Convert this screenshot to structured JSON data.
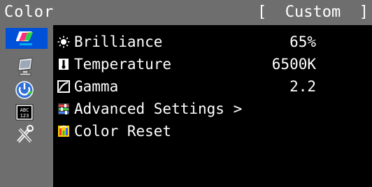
{
  "header": {
    "title": "Color",
    "mode_open": "[",
    "mode_value": "Custom",
    "mode_close": "]"
  },
  "sidebar": {
    "items": [
      {
        "icon": "color-icon",
        "selected": true
      },
      {
        "icon": "screen-icon",
        "selected": false
      },
      {
        "icon": "power-icon",
        "selected": false
      },
      {
        "icon": "language-icon",
        "selected": false
      },
      {
        "icon": "tools-icon",
        "selected": false
      }
    ]
  },
  "menu": {
    "items": [
      {
        "icon": "brilliance-icon",
        "label": "Brilliance",
        "value": "65%"
      },
      {
        "icon": "temperature-icon",
        "label": "Temperature",
        "value": "6500K"
      },
      {
        "icon": "gamma-icon",
        "label": "Gamma",
        "value": "2.2"
      },
      {
        "icon": "advanced-settings-icon",
        "label": "Advanced Settings >",
        "value": ""
      },
      {
        "icon": "color-reset-icon",
        "label": "Color Reset",
        "value": ""
      }
    ]
  },
  "colors": {
    "background": "#000000",
    "frame": "#6e6e6e",
    "selection": "#0050d8",
    "text": "#ffffff"
  }
}
